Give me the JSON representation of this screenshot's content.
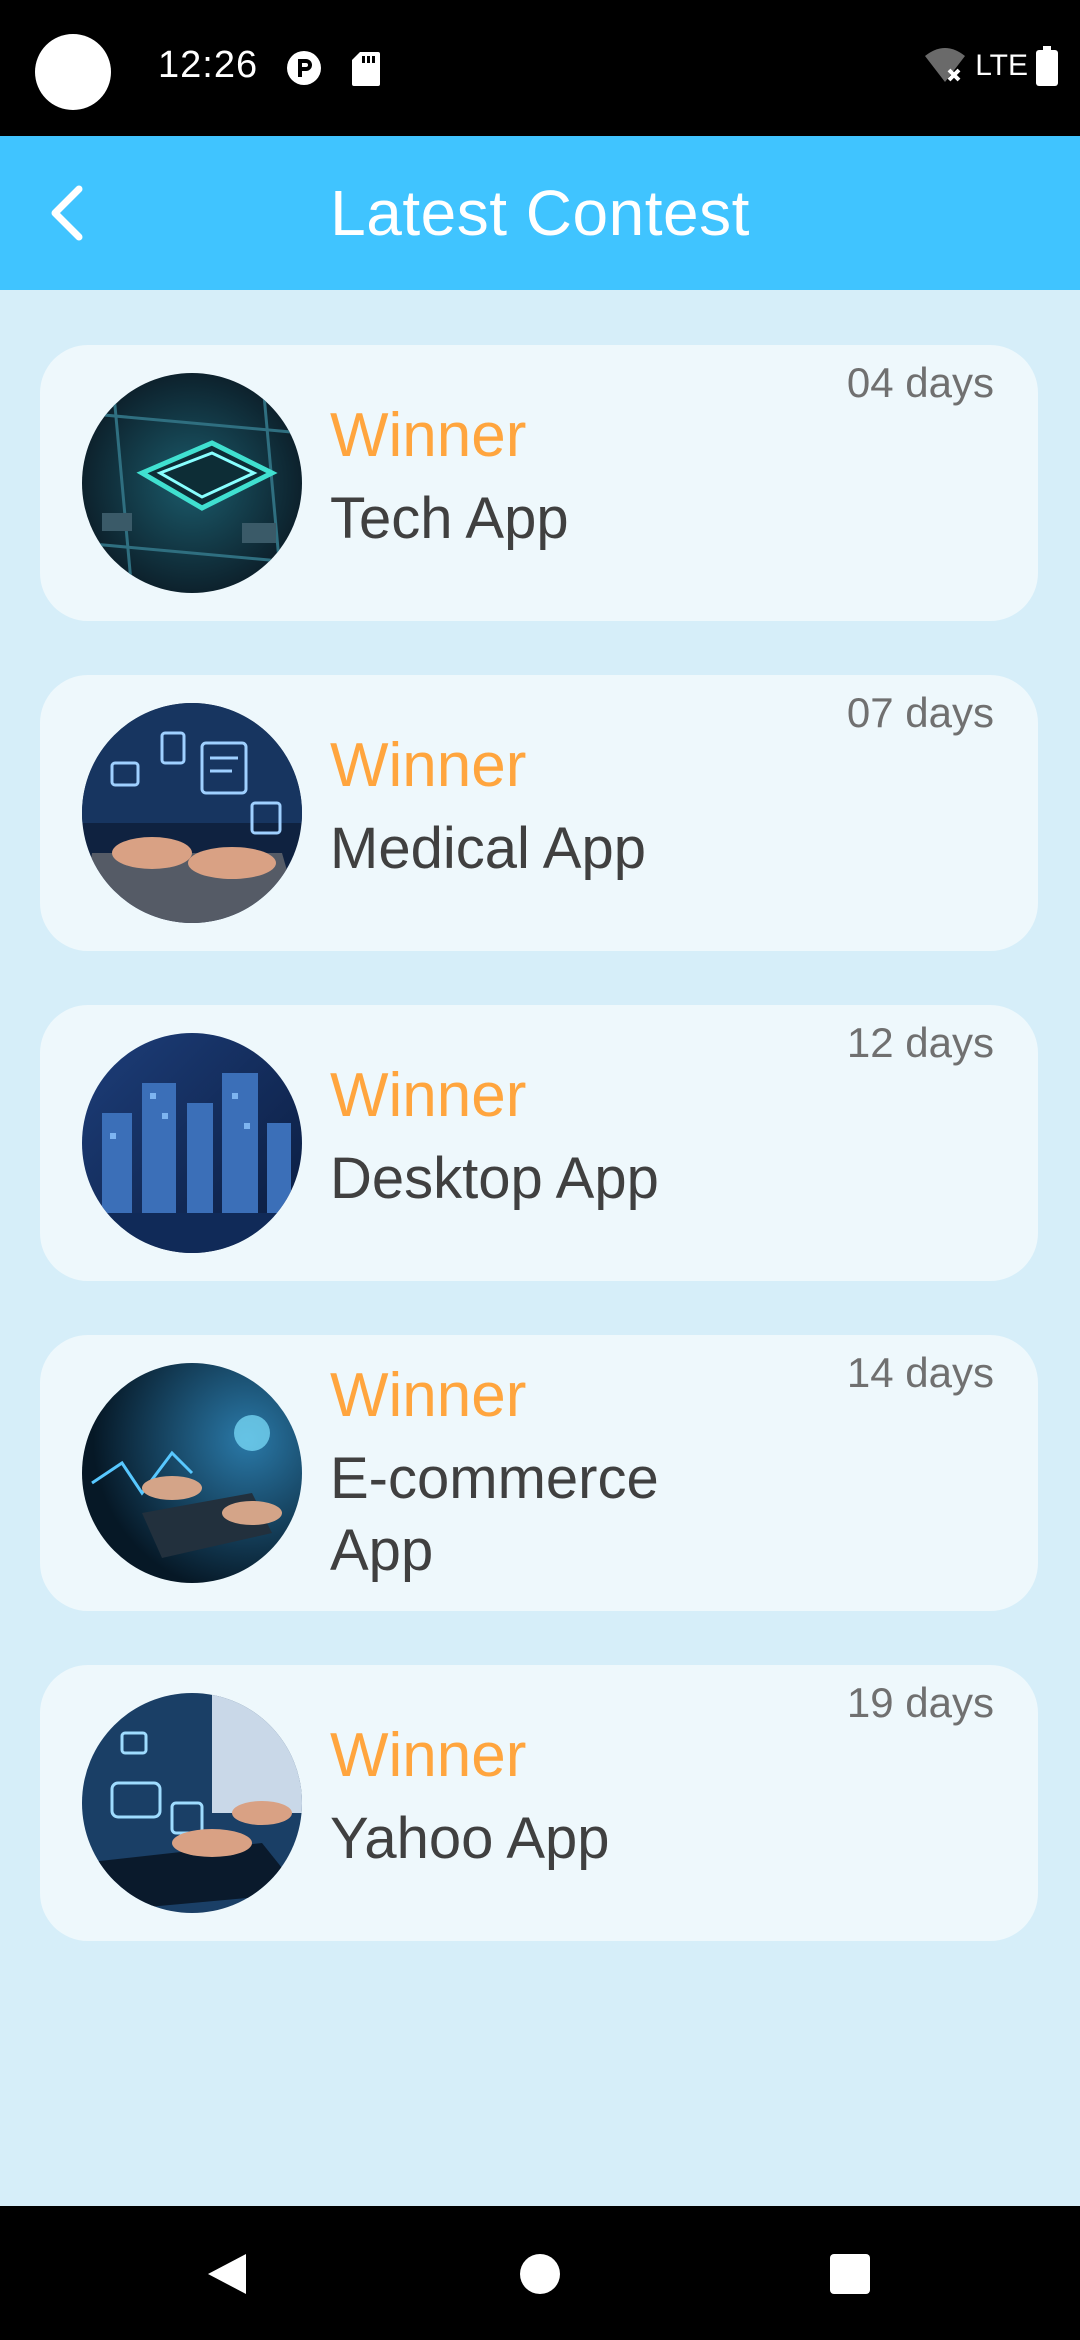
{
  "status_bar": {
    "time": "12:26",
    "network": "LTE",
    "icons": [
      "camera-dot",
      "p-icon",
      "sd-card-icon",
      "wifi-off-icon",
      "battery-icon"
    ]
  },
  "app_bar": {
    "title": "Latest Contest",
    "back_icon": "chevron-left-icon",
    "background": "#40c4ff"
  },
  "contests": [
    {
      "label": "Winner",
      "name": "Tech App",
      "days": "04 days",
      "image": "circuit-chip"
    },
    {
      "label": "Winner",
      "name": "Medical App",
      "days": "07 days",
      "image": "laptop-ui"
    },
    {
      "label": "Winner",
      "name": "Desktop App",
      "days": "12 days",
      "image": "digital-city"
    },
    {
      "label": "Winner",
      "name": "E-commerce App",
      "days": "14 days",
      "image": "hands-tablet"
    },
    {
      "label": "Winner",
      "name": "Yahoo App",
      "days": "19 days",
      "image": "erp-laptop"
    }
  ],
  "colors": {
    "winner": "#ffa53e",
    "name": "#404040",
    "days": "#707070",
    "content_bg": "#d6eef9",
    "card_bg": "#eef8fc"
  },
  "nav_bar": {
    "icons": [
      "nav-back-icon",
      "nav-home-icon",
      "nav-recents-icon"
    ]
  }
}
